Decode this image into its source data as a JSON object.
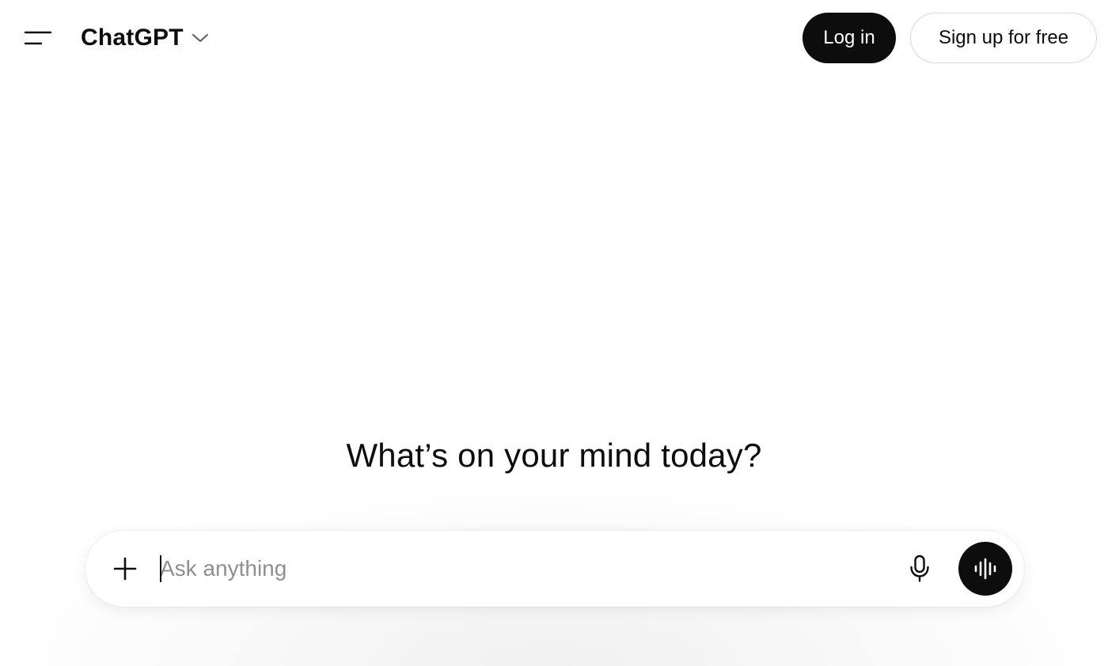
{
  "header": {
    "model_name": "ChatGPT",
    "login_label": "Log in",
    "signup_label": "Sign up for free"
  },
  "icons": {
    "sidebar_toggle": "sidebar-toggle-icon",
    "model_dropdown": "chevron-down-icon",
    "attach": "plus-icon",
    "dictate": "microphone-icon",
    "voice_mode": "voice-waveform-icon"
  },
  "main": {
    "headline": "What’s on your mind today?"
  },
  "composer": {
    "placeholder": "Ask anything",
    "value": ""
  },
  "colors": {
    "text": "#0d0d0d",
    "primary_button_bg": "#0d0d0d",
    "primary_button_text": "#ffffff",
    "placeholder": "#8f8f8f",
    "outline_border": "#d9d9d9"
  }
}
